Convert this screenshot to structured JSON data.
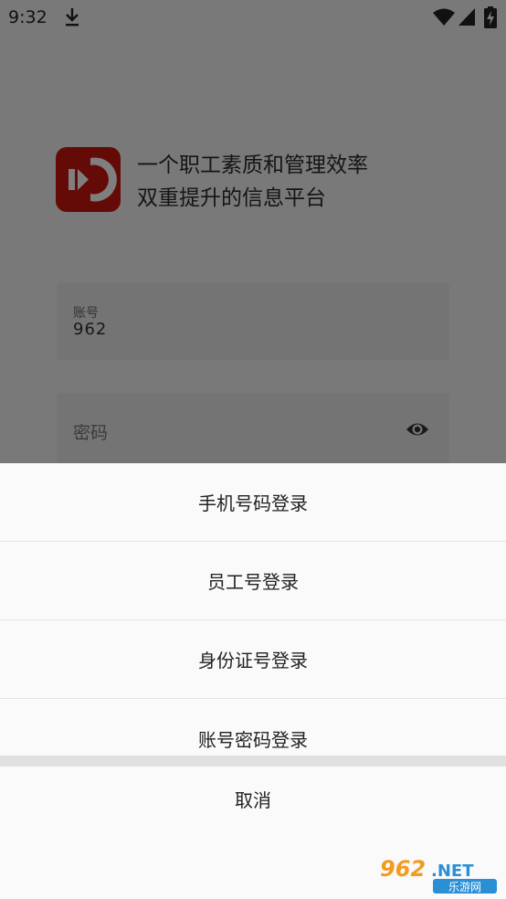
{
  "status_bar": {
    "time": "9:32"
  },
  "app": {
    "slogan_line1": "一个职工素质和管理效率",
    "slogan_line2": "双重提升的信息平台"
  },
  "login_form": {
    "account_label": "账号",
    "account_value": "962",
    "password_placeholder": "密码"
  },
  "bottom_sheet": {
    "options": [
      {
        "label": "手机号码登录"
      },
      {
        "label": "员工号登录"
      },
      {
        "label": "身份证号登录"
      },
      {
        "label": "账号密码登录"
      }
    ],
    "cancel_label": "取消"
  },
  "watermark": {
    "main": "962.NET",
    "sub": "乐游网"
  },
  "colors": {
    "brand_red": "#c8170f",
    "scrim": "rgba(0,0,0,0.5)",
    "sheet_bg": "#fafafa"
  }
}
